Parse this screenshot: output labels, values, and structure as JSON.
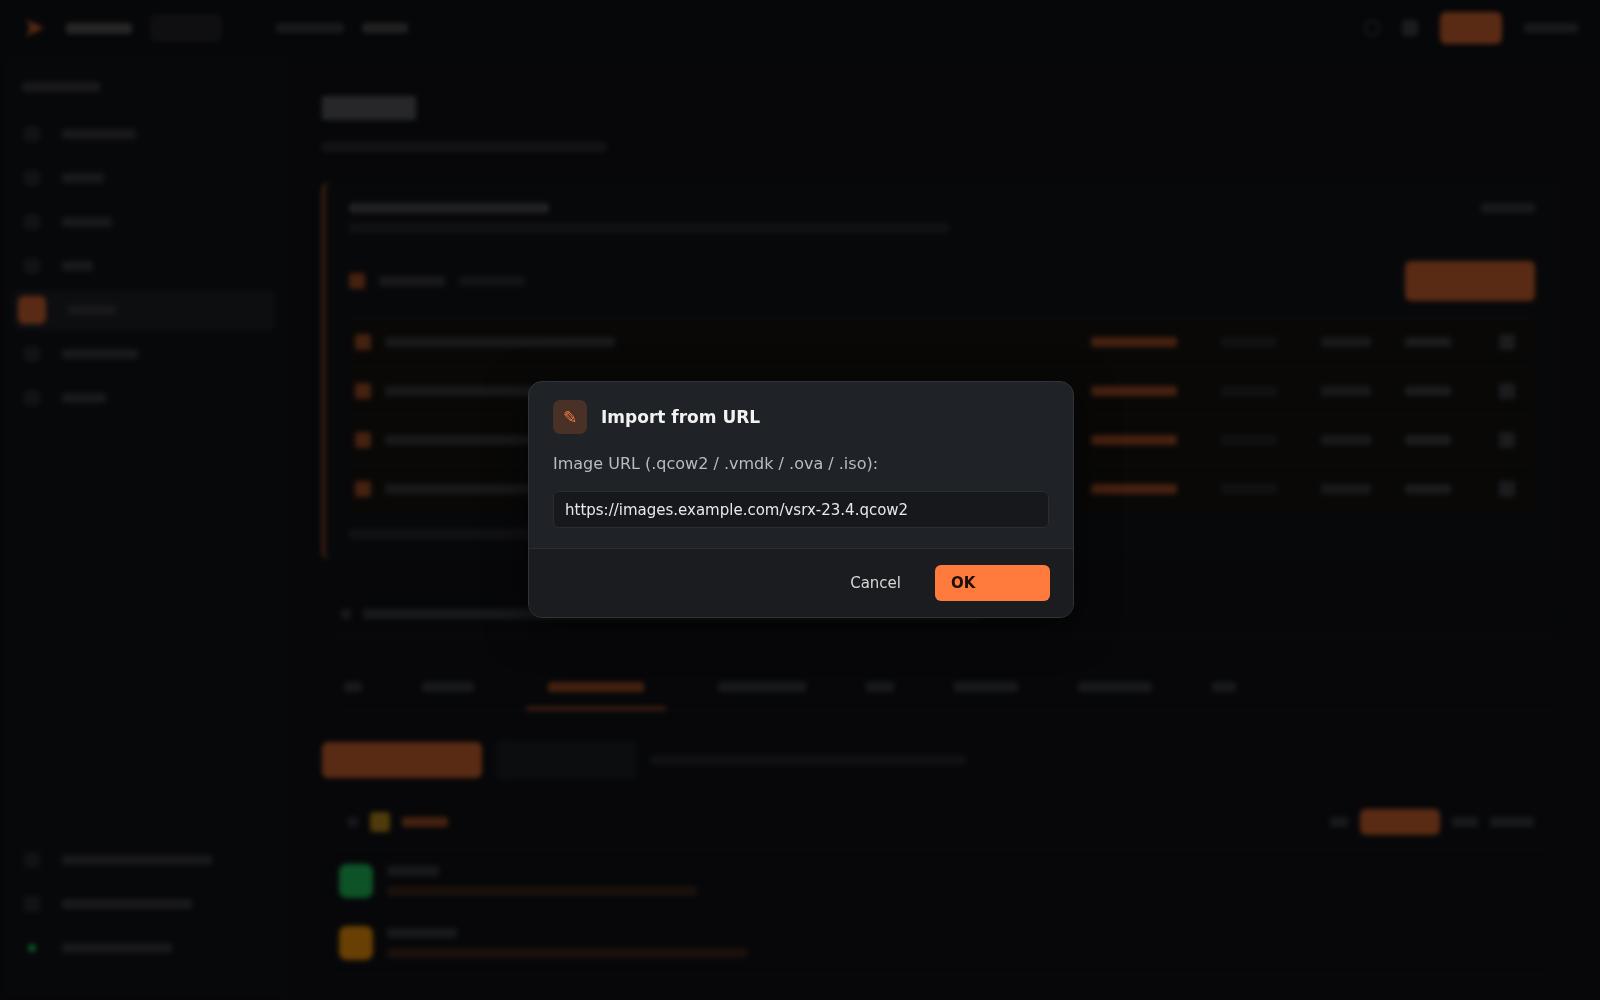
{
  "dialog": {
    "title": "Import from URL",
    "icon": "✎",
    "label": "Image URL (.qcow2 / .vmdk / .ova / .iso):",
    "value": "https://images.example.com/vsrx-23.4.qcow2",
    "cancel": "Cancel",
    "ok": "OK"
  }
}
